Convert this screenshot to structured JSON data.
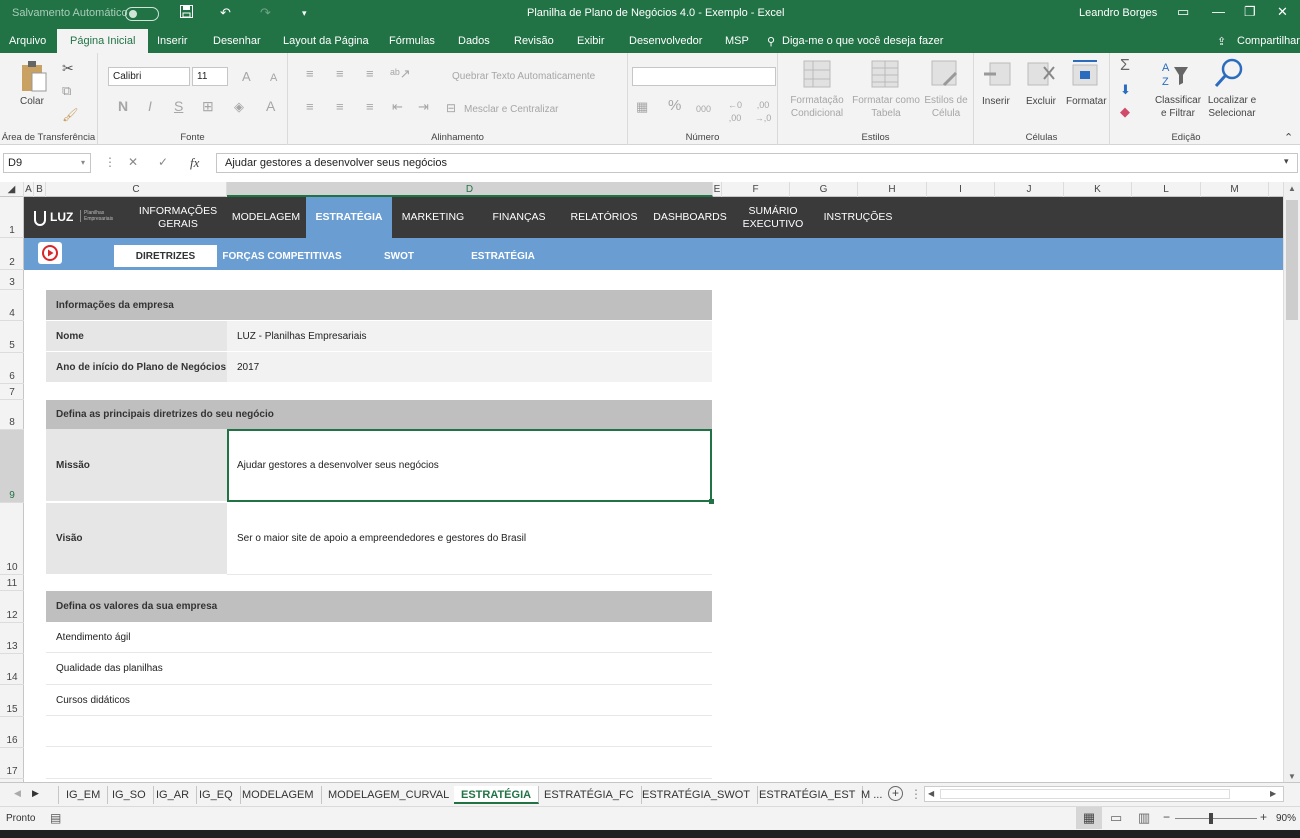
{
  "titlebar": {
    "autosave_label": "Salvamento Automático",
    "window_title": "Planilha de Plano de Negócios 4.0 - Exemplo  -  Excel",
    "user": "Leandro Borges"
  },
  "ribbon_tabs": [
    "Arquivo",
    "Página Inicial",
    "Inserir",
    "Desenhar",
    "Layout da Página",
    "Fórmulas",
    "Dados",
    "Revisão",
    "Exibir",
    "Desenvolvedor",
    "MSP"
  ],
  "tell_me": "Diga-me o que você deseja fazer",
  "share": "Compartilhar",
  "ribbon": {
    "clipboard": {
      "paste": "Colar",
      "group": "Área de Transferência"
    },
    "font": {
      "name": "Calibri",
      "size": "11",
      "group": "Fonte",
      "bold": "N",
      "italic": "I",
      "underline": "S",
      "grow": "A",
      "shrink": "A",
      "font_color": "A"
    },
    "alignment": {
      "wrap": "Quebrar Texto Automaticamente",
      "merge": "Mesclar e Centralizar",
      "group": "Alinhamento"
    },
    "number": {
      "group": "Número",
      "percent": "%",
      "thousands": "000",
      "inc_dec": "←0 ,00",
      "dec_dec": ",00 →,0"
    },
    "styles": {
      "conditional": "Formatação Condicional",
      "table": "Formatar como Tabela",
      "cell": "Estilos de Célula",
      "group": "Estilos"
    },
    "cells": {
      "insert": "Inserir",
      "delete": "Excluir",
      "format": "Formatar",
      "group": "Células"
    },
    "editing": {
      "sort": "Classificar e Filtrar",
      "find": "Localizar e Selecionar",
      "group": "Edição",
      "sum": "Σ"
    }
  },
  "formula_bar": {
    "name_box": "D9",
    "fx": "fx",
    "cancel": "✕",
    "enter": "✓",
    "content": "Ajudar gestores a desenvolver seus negócios"
  },
  "columns": [
    "A",
    "B",
    "C",
    "D",
    "E",
    "F",
    "G",
    "H",
    "I",
    "J",
    "K",
    "L",
    "M"
  ],
  "rows": [
    "1",
    "2",
    "3",
    "4",
    "5",
    "6",
    "7",
    "8",
    "9",
    "10",
    "11",
    "12",
    "13",
    "14",
    "15",
    "16",
    "17"
  ],
  "app_nav": {
    "logo": "LUZ",
    "logo_sub": "Planilhas Empresariais",
    "items": [
      "INFORMAÇÕES GERAIS",
      "MODELAGEM",
      "ESTRATÉGIA",
      "MARKETING",
      "FINANÇAS",
      "RELATÓRIOS",
      "DASHBOARDS",
      "SUMÁRIO EXECUTIVO",
      "INSTRUÇÕES"
    ],
    "active": "ESTRATÉGIA"
  },
  "sub_nav": {
    "items": [
      "DIRETRIZES",
      "FORÇAS COMPETITIVAS",
      "SWOT",
      "ESTRATÉGIA"
    ],
    "active": "DIRETRIZES"
  },
  "company_info": {
    "header": "Informações da empresa",
    "name_label": "Nome",
    "name_value": "LUZ - Planilhas Empresariais",
    "year_label": "Ano de início do Plano de Negócios",
    "year_value": "2017"
  },
  "guidelines": {
    "header": "Defina as principais diretrizes do seu negócio",
    "mission_label": "Missão",
    "mission_value": "Ajudar gestores a desenvolver seus negócios",
    "vision_label": "Visão",
    "vision_value": "Ser o maior site de apoio a empreendedores e gestores do Brasil"
  },
  "values": {
    "header": "Defina os valores da sua empresa",
    "items": [
      "Atendimento ágil",
      "Qualidade das planilhas",
      "Cursos didáticos",
      "",
      ""
    ]
  },
  "sheet_tabs": [
    "IG_EM",
    "IG_SO",
    "IG_AR",
    "IG_EQ",
    "MODELAGEM",
    "MODELAGEM_CURVAL",
    "ESTRATÉGIA",
    "ESTRATÉGIA_FC",
    "ESTRATÉGIA_SWOT",
    "ESTRATÉGIA_EST",
    "M ..."
  ],
  "active_sheet": "ESTRATÉGIA",
  "status": {
    "ready": "Pronto",
    "zoom": "90%"
  },
  "colors": {
    "excel_green": "#217346",
    "nav_dark": "#3a3a3a",
    "nav_blue": "#6a9ed3",
    "section_gray": "#bfbfbf"
  }
}
